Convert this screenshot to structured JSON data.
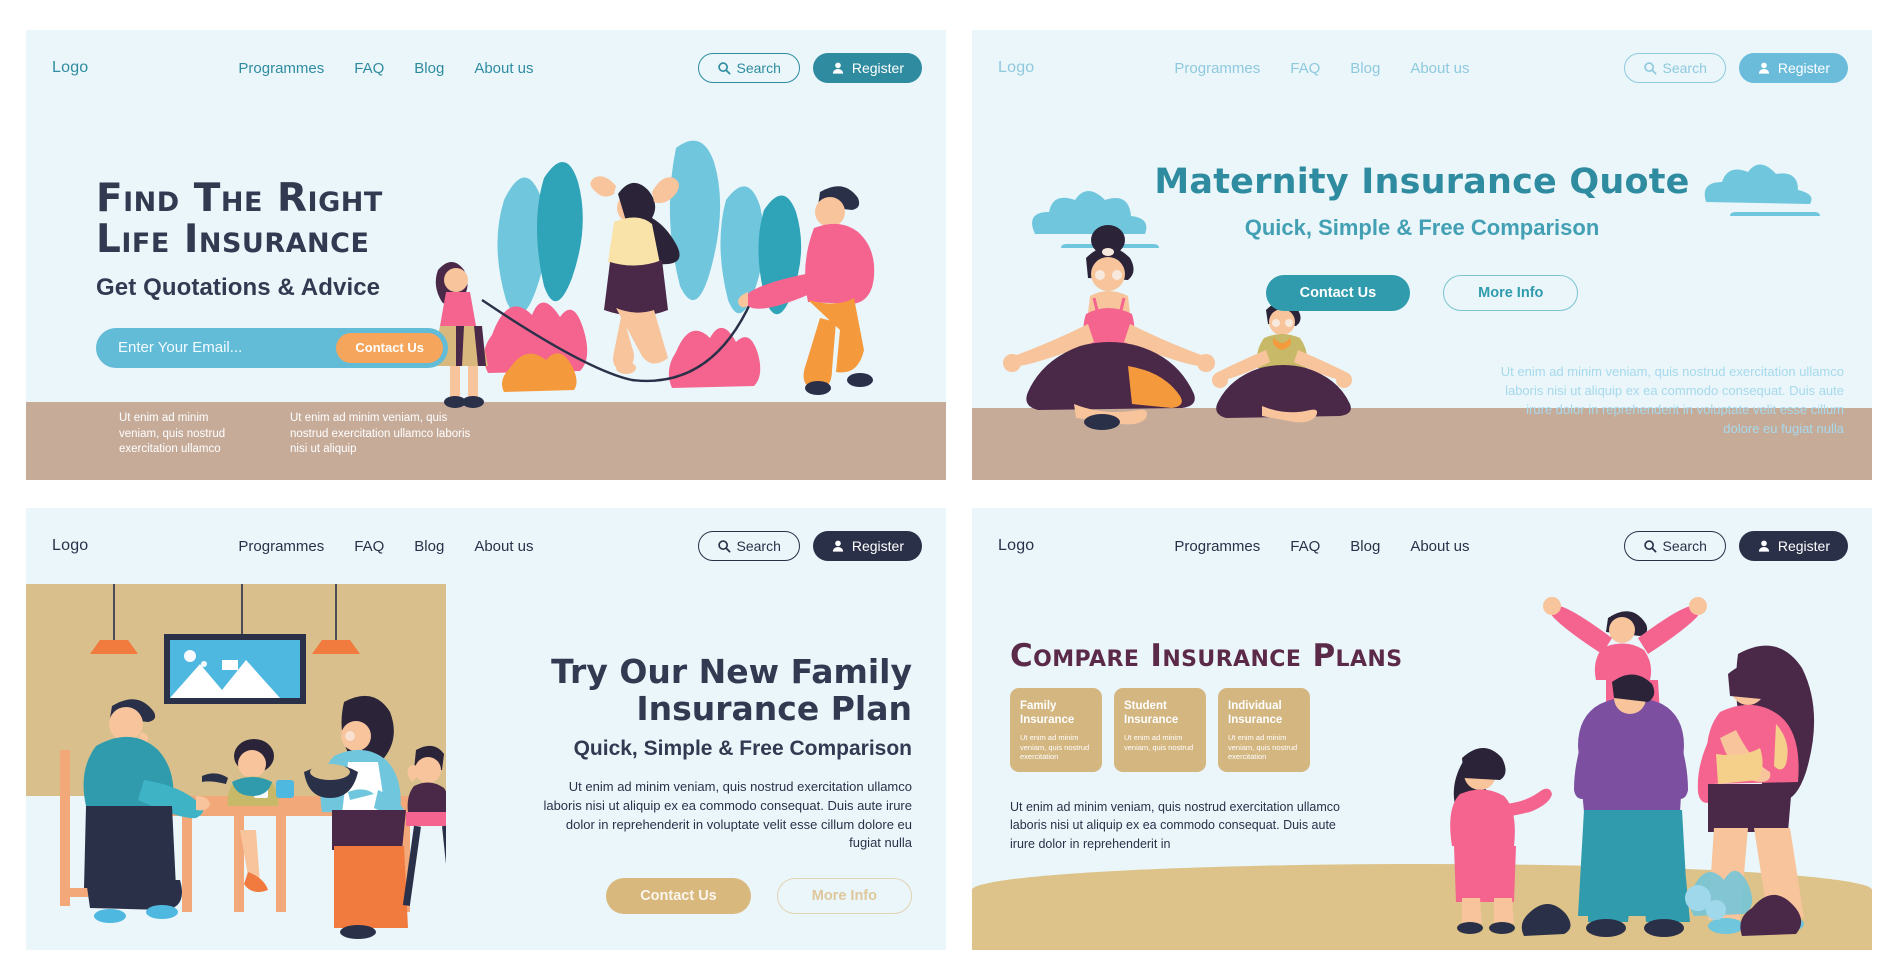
{
  "nav": {
    "logo": "Logo",
    "links": [
      "Programmes",
      "FAQ",
      "Blog",
      "About us"
    ],
    "search_label": "Search",
    "register_label": "Register",
    "search_icon": "search-icon",
    "user_icon": "user-icon"
  },
  "panel1": {
    "heading_line1": "Find The Right",
    "heading_line2": "Life Insurance",
    "subheading": "Get Quotations & Advice",
    "email_placeholder": "Enter Your Email...",
    "email_value": "",
    "contact_label": "Contact Us",
    "footer_left": "Ut enim ad minim veniam, quis nostrud exercitation ullamco",
    "footer_right": "Ut enim ad minim veniam, quis nostrud exercitation ullamco laboris nisi ut aliquip",
    "colors": {
      "background": "#eaf6fa",
      "ground": "#c6ab99",
      "accent": "#2f8ca0",
      "field": "#62bcd8",
      "cta": "#f6a55c",
      "heading": "#323a52"
    }
  },
  "panel2": {
    "title": "Maternity Insurance Quote",
    "subtitle": "Quick, Simple & Free Comparison",
    "contact_label": "Contact Us",
    "more_label": "More Info",
    "paragraph": "Ut enim ad minim veniam, quis nostrud exercitation ullamco laboris nisi ut aliquip ex ea commodo consequat. Duis aute irure dolor in reprehenderit in voluptate velit esse cillum dolore eu fugiat nulla",
    "colors": {
      "background": "#eaf6fa",
      "ground": "#c6ab99",
      "title": "#2f8ca0",
      "subtitle": "#43a0b4",
      "cta": "#2f9bad",
      "paragraph": "#a6d9ec",
      "nav": "#8fc9de"
    }
  },
  "panel3": {
    "title_line1": "Try Our New Family",
    "title_line2": "Insurance Plan",
    "subtitle": "Quick, Simple & Free Comparison",
    "paragraph": "Ut enim ad minim veniam, quis nostrud exercitation ullamco laboris nisi ut aliquip ex ea commodo consequat. Duis aute irure dolor in reprehenderit in voluptate velit esse cillum dolore eu fugiat nulla",
    "contact_label": "Contact Us",
    "more_label": "More Info",
    "colors": {
      "background": "#eaf6fa",
      "wall": "#d8bf8c",
      "heading": "#323a52",
      "cta": "#d9b87e",
      "nav": "#2b3049"
    }
  },
  "panel4": {
    "title": "Compare Insurance Plans",
    "cards": [
      {
        "title": "Family Insurance",
        "body": "Ut enim ad minim veniam, quis nostrud exercitation"
      },
      {
        "title": "Student Insurance",
        "body": "Ut enim ad minim veniam, quis nostrud"
      },
      {
        "title": "Individual Insurance",
        "body": "Ut enim ad minim veniam, quis nostrud exercitation"
      }
    ],
    "paragraph": "Ut enim ad minim veniam, quis nostrud exercitation ullamco laboris nisi ut aliquip ex ea commodo consequat. Duis aute irure dolor in reprehenderit in",
    "colors": {
      "background": "#eaf6fa",
      "ground": "#ddc389",
      "title": "#5b2a49",
      "card": "#d3b680",
      "nav": "#2b3049"
    }
  }
}
